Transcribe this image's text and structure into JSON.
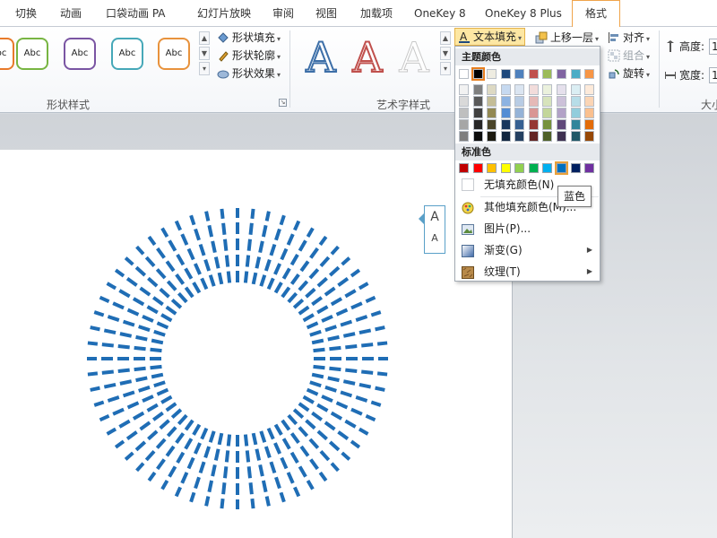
{
  "tabs": [
    "切换",
    "动画",
    "口袋动画 PA",
    "幻灯片放映",
    "审阅",
    "视图",
    "加载项",
    "OneKey 8",
    "OneKey 8 Plus",
    "格式"
  ],
  "shape_styles": {
    "label": "形状样式",
    "preset_text": "Abc",
    "preset_colors": [
      "#e87a2a",
      "#78b542",
      "#7a55a3",
      "#46a8b8",
      "#e8923c"
    ],
    "fill": "形状填充",
    "outline": "形状轮廓",
    "effects": "形状效果"
  },
  "wordart": {
    "label": "艺术字样式",
    "glyph": "A",
    "text_fill": "文本填充"
  },
  "arrange": {
    "bring_forward": "上移一层",
    "align": "对齐",
    "group": "组合",
    "rotate": "旋转"
  },
  "size": {
    "label": "大小",
    "height_label": "高度:",
    "height_value": "1",
    "width_label": "宽度:",
    "width_value": "1"
  },
  "menu": {
    "theme_colors_label": "主题颜色",
    "theme_top_row": [
      "#ffffff",
      "#000000",
      "#eeece1",
      "#1f497d",
      "#4f81bd",
      "#c0504d",
      "#9bbb59",
      "#8064a2",
      "#4bacc6",
      "#f79646"
    ],
    "theme_shade_columns": [
      [
        "#f2f2f2",
        "#d9d9d9",
        "#bfbfbf",
        "#a6a6a6",
        "#7f7f7f"
      ],
      [
        "#7f7f7f",
        "#595959",
        "#404040",
        "#262626",
        "#0d0d0d"
      ],
      [
        "#ddd9c3",
        "#c4bd97",
        "#938953",
        "#4a452a",
        "#1d1b10"
      ],
      [
        "#c6d9f0",
        "#8db3e2",
        "#548dd4",
        "#17365d",
        "#0f243e"
      ],
      [
        "#dbe5f1",
        "#b8cce4",
        "#95b3d7",
        "#366092",
        "#244061"
      ],
      [
        "#f2dcdb",
        "#e5b9b7",
        "#d99694",
        "#953734",
        "#632423"
      ],
      [
        "#ebf1dd",
        "#d7e3bc",
        "#c3d69b",
        "#76923c",
        "#4f6128"
      ],
      [
        "#e5e0ec",
        "#ccc1d9",
        "#b2a2c7",
        "#5f497a",
        "#3f3151"
      ],
      [
        "#dbeef3",
        "#b7dde8",
        "#92cddc",
        "#31859b",
        "#205867"
      ],
      [
        "#fdeada",
        "#fbd5b5",
        "#fac08f",
        "#e36c09",
        "#974806"
      ]
    ],
    "standard_colors_label": "标准色",
    "standard_colors": [
      "#c00000",
      "#ff0000",
      "#ffc000",
      "#ffff00",
      "#92d050",
      "#00b050",
      "#00b0f0",
      "#0070c0",
      "#002060",
      "#7030a0"
    ],
    "no_fill": "无填充颜色(N)",
    "more_colors": "其他填充颜色(M)...",
    "picture": "图片(P)...",
    "gradient": "渐变(G)",
    "texture": "纹理(T)"
  },
  "tooltip": "蓝色",
  "mini_toolbar": {
    "grow": "A",
    "shrink": "A"
  },
  "colors": {
    "ray": "#1f6db5",
    "accent_tab": "#f0a44b"
  }
}
